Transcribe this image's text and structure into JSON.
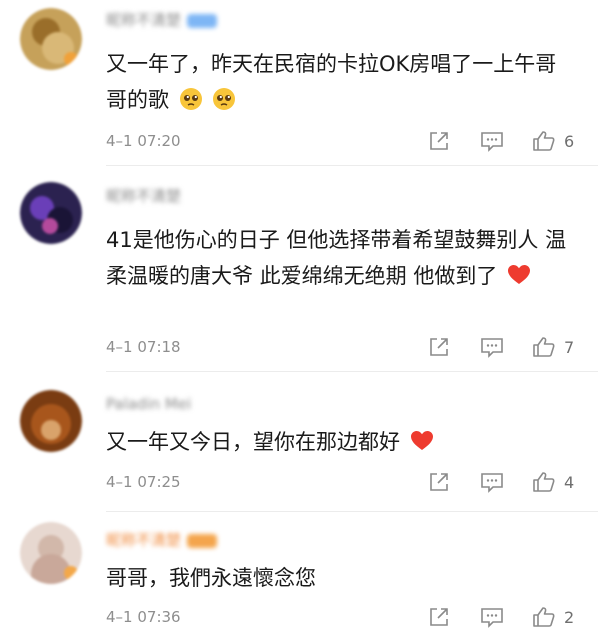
{
  "comments": [
    {
      "username": "昵称不清楚",
      "text": "又一年了，昨天在民宿的卡拉OK房唱了一上午哥哥的歌",
      "emojis": [
        "pleading-face-emoji",
        "pleading-face-emoji"
      ],
      "time": "4–1 07:20",
      "like_count": "6",
      "avatar_color": "#b58a3e",
      "badge_color": "#f0a13a",
      "tag_color": "#7eb6f5"
    },
    {
      "username": "昵称不清楚",
      "text": "41是他伤心的日子 但他选择带着希望鼓舞别人 温柔温暖的唐大爷 此爱绵绵无绝期 他做到了",
      "emojis": [
        "red-heart-emoji"
      ],
      "time": "4–1 07:18",
      "like_count": "7",
      "avatar_color": "#2b2250",
      "badge_color": "",
      "tag_color": ""
    },
    {
      "username": "Paladin Mei",
      "text": "又一年又今日，望你在那边都好",
      "emojis": [
        "red-heart-emoji"
      ],
      "time": "4–1 07:25",
      "like_count": "4",
      "avatar_color": "#7a3c12",
      "badge_color": "",
      "tag_color": ""
    },
    {
      "username": "昵称不清楚",
      "text": "哥哥，我們永遠懷念您",
      "emojis": [],
      "time": "4–1 07:36",
      "like_count": "2",
      "avatar_color": "#e7d8d0",
      "badge_color": "#f3a84a",
      "tag_color": "#f4a54c"
    }
  ],
  "colors": {
    "heart": "#ee3b2f",
    "emoji_face": "#f8c53a",
    "icon_stroke": "#8a8a8a"
  }
}
